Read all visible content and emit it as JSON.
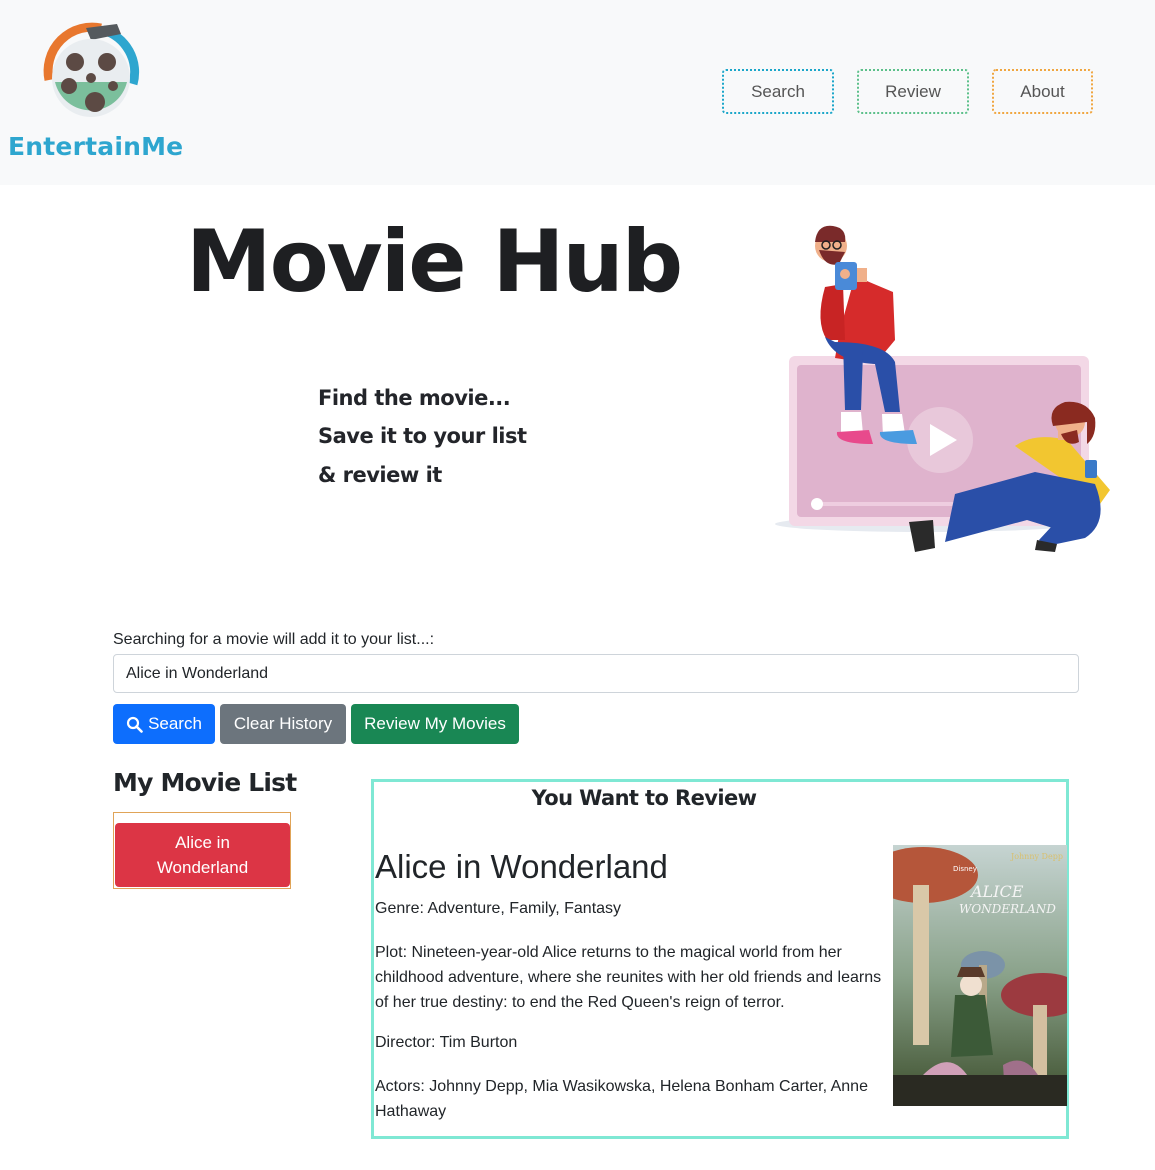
{
  "brand": {
    "name": "EntertainMe"
  },
  "nav": {
    "search": "Search",
    "review": "Review",
    "about": "About"
  },
  "hero": {
    "title": "Movie Hub",
    "taglines": [
      "Find the movie...",
      "Save it to your list",
      "& review it"
    ]
  },
  "search": {
    "label": "Searching for a movie will add it to your list...:",
    "value": "Alice in Wonderland",
    "buttons": {
      "search": "Search",
      "clear": "Clear History",
      "review": "Review My Movies"
    }
  },
  "list": {
    "heading": "My Movie List",
    "items": [
      "Alice in Wonderland"
    ]
  },
  "review": {
    "heading": "You Want to Review",
    "title": "Alice in Wonderland",
    "genre": "Genre: Adventure, Family, Fantasy",
    "plot": "Plot: Nineteen-year-old Alice returns to the magical world from her childhood adventure, where she reunites with her old friends and learns of her true destiny: to end the Red Queen's reign of terror.",
    "director": "Director: Tim Burton",
    "actors": "Actors: Johnny Depp, Mia Wasikowska, Helena Bonham Carter, Anne Hathaway",
    "poster": {
      "studio": "Disney",
      "title_art": "ALICE IN WONDERLAND",
      "credit": "Johnny Depp"
    }
  },
  "colors": {
    "nav_search_border": "#1ba6c9",
    "nav_review_border": "#5cc08a",
    "nav_about_border": "#f0a640",
    "primary": "#0d6efd",
    "secondary": "#6c757d",
    "success": "#198754",
    "danger": "#dc3545",
    "panel_border": "#7fe8d4"
  }
}
